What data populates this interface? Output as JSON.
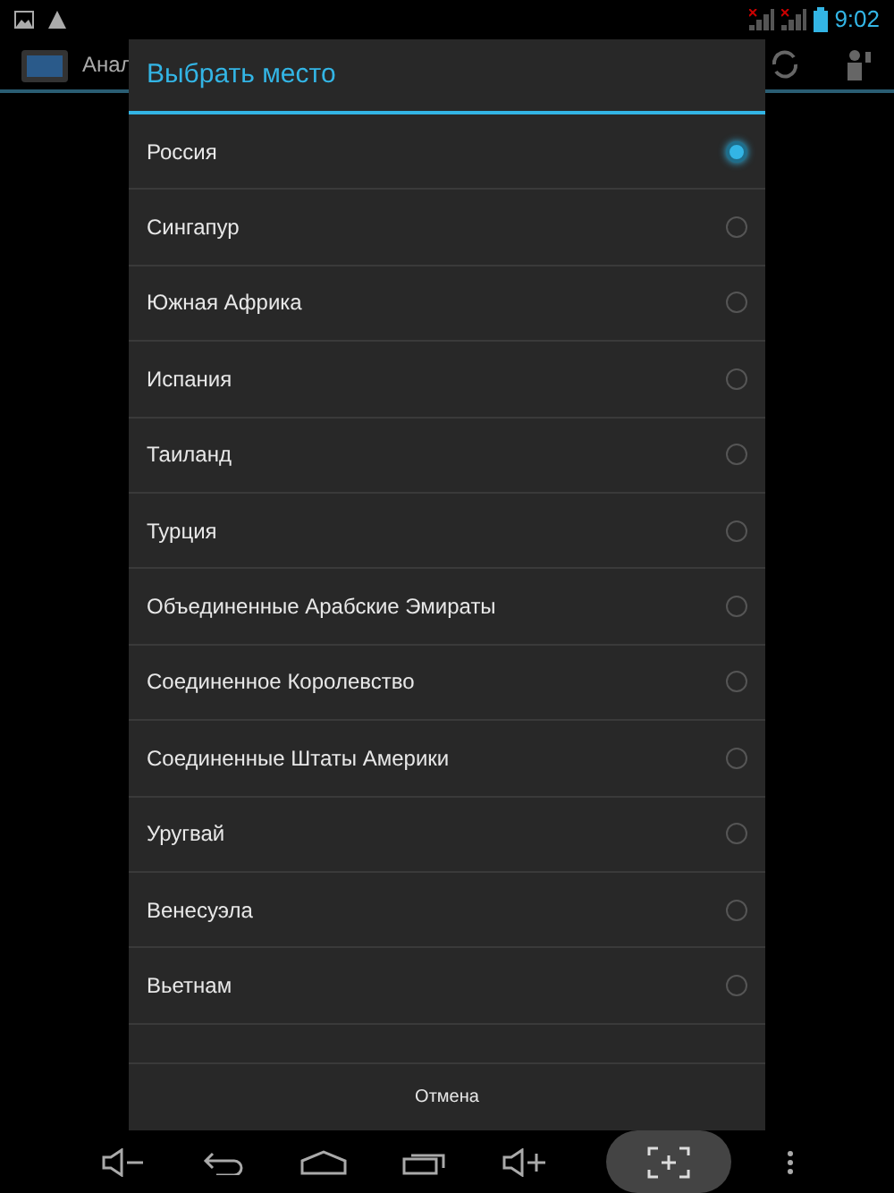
{
  "status_bar": {
    "time": "9:02"
  },
  "action_bar": {
    "title": "Анал"
  },
  "dialog": {
    "title": "Выбрать место",
    "options": [
      {
        "label": "Россия",
        "selected": true
      },
      {
        "label": "Сингапур",
        "selected": false
      },
      {
        "label": "Южная Африка",
        "selected": false
      },
      {
        "label": "Испания",
        "selected": false
      },
      {
        "label": "Таиланд",
        "selected": false
      },
      {
        "label": "Турция",
        "selected": false
      },
      {
        "label": "Объединенные Арабские Эмираты",
        "selected": false
      },
      {
        "label": "Соединенное Королевство",
        "selected": false
      },
      {
        "label": "Соединенные Штаты Америки",
        "selected": false
      },
      {
        "label": "Уругвай",
        "selected": false
      },
      {
        "label": "Венесуэла",
        "selected": false
      },
      {
        "label": "Вьетнам",
        "selected": false
      }
    ],
    "cancel_button": "Отмена"
  }
}
